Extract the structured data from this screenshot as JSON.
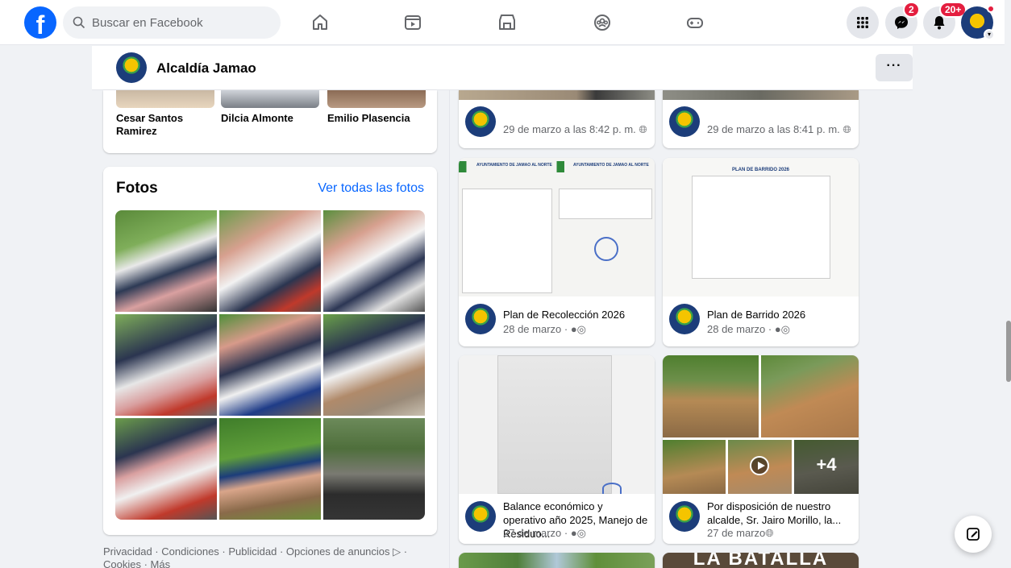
{
  "topbar": {
    "logo": "f",
    "search_placeholder": "Buscar en Facebook",
    "messenger_badge": "2",
    "notifications_badge": "20+"
  },
  "page": {
    "name": "Alcaldía Jamao",
    "more_label": "···"
  },
  "friends": [
    {
      "name": "Cesar Santos Ramirez"
    },
    {
      "name": "Dilcia Almonte"
    },
    {
      "name": "Emilio Plasencia"
    }
  ],
  "photos": {
    "title": "Fotos",
    "see_all": "Ver todas las fotos"
  },
  "footer": {
    "text": "Privacidad · Condiciones · Publicidad · Opciones de anuncios ▷ · Cookies · Más"
  },
  "posts": [
    {
      "title": "",
      "date": "29 de marzo a las 8:42 p. m."
    },
    {
      "title": "",
      "date": "29 de marzo a las 8:41 p. m."
    },
    {
      "title": "Plan de Recolección 2026",
      "date": "28 de marzo ·",
      "doc_header": "AYUNTAMIENTO DE JAMAO AL NORTE",
      "doc_header2": "AYUNTAMIENTO DE JAMAO AL NORTE"
    },
    {
      "title": "Plan de Barrido 2026",
      "date": "28 de marzo ·",
      "doc_header": "PLAN DE BARRIDO 2026"
    },
    {
      "title": "Balance económico y operativo año 2025, Manejo de Residuo...",
      "date": "27 de marzo ·"
    },
    {
      "title": "Por disposición de nuestro alcalde, Sr. Jairo Morillo, la...",
      "date": "27 de marzo",
      "more_count": "+4"
    }
  ],
  "bottom_banner": "LA BATALLA",
  "colors": {
    "brand": "#0866ff",
    "badge": "#e41e3f",
    "bg": "#f0f2f5"
  }
}
